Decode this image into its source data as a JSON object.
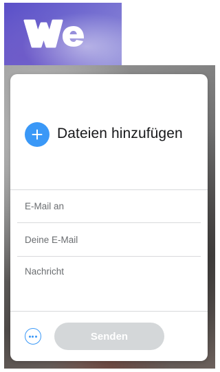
{
  "brand": {
    "logo_text": "we",
    "logo_icon": "wetransfer-logo"
  },
  "upload": {
    "icon": "plus-icon",
    "label": "Dateien hinzufügen"
  },
  "form": {
    "email_to_placeholder": "E-Mail an",
    "email_to_value": "",
    "your_email_placeholder": "Deine E-Mail",
    "your_email_value": "",
    "message_placeholder": "Nachricht",
    "message_value": ""
  },
  "footer": {
    "more_icon": "more-options-icon",
    "send_label": "Senden",
    "send_enabled": false
  },
  "colors": {
    "accent": "#3a98f7",
    "brand_purple": "#5b4fc8",
    "send_disabled": "#d4d7d9",
    "divider": "#d8d9db"
  }
}
